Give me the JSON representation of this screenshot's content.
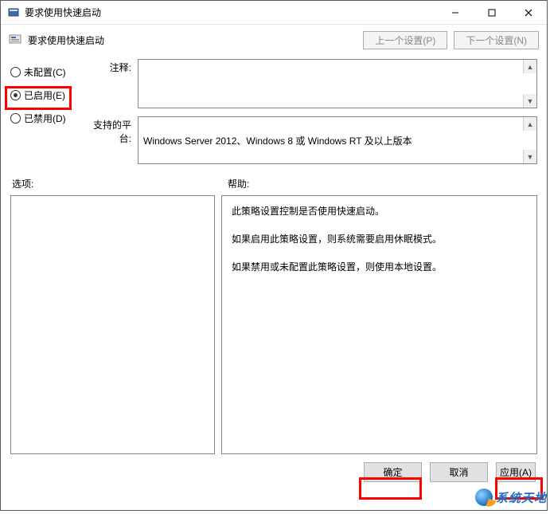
{
  "window": {
    "title": "要求使用快速启动",
    "header_title": "要求使用快速启动"
  },
  "header_buttons": {
    "prev": "上一个设置(P)",
    "next": "下一个设置(N)"
  },
  "radios": {
    "not_configured": "未配置(C)",
    "enabled": "已启用(E)",
    "disabled": "已禁用(D)"
  },
  "labels": {
    "comment": "注释:",
    "platform": "支持的平台:",
    "options": "选项:",
    "help": "帮助:"
  },
  "platform_text": "Windows Server 2012、Windows 8 或 Windows RT 及以上版本",
  "help": {
    "p1": "此策略设置控制是否使用快速启动。",
    "p2": "如果启用此策略设置，则系统需要启用休眠模式。",
    "p3": "如果禁用或未配置此策略设置，则使用本地设置。"
  },
  "footer": {
    "ok": "确定",
    "cancel": "取消",
    "apply": "应用(A)"
  },
  "watermark": "系统天地"
}
